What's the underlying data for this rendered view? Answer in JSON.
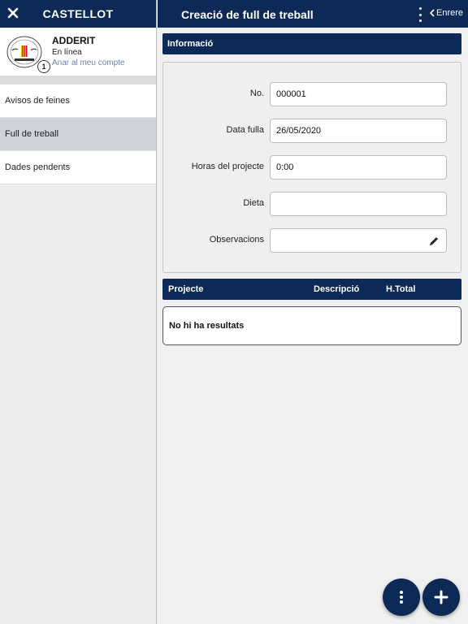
{
  "sidebar": {
    "title": "CASTELLOT",
    "profile": {
      "name": "ADDERIT",
      "status": "En línea",
      "account_link": "Anar al meu compte",
      "badge_count": "1"
    },
    "items": [
      {
        "label": "Avisos de feines",
        "active": false
      },
      {
        "label": "Full de treball",
        "active": true
      },
      {
        "label": "Dades pendents",
        "active": false
      }
    ]
  },
  "header": {
    "title": "Creació de full de treball",
    "back_label": "Enrere",
    "menu_icon": "kebab-menu-icon"
  },
  "info_section": {
    "title": "Informació",
    "fields": [
      {
        "label": "No.",
        "value": "000001"
      },
      {
        "label": "Data fulla",
        "value": "26/05/2020"
      },
      {
        "label": "Horas del projecte",
        "value": "0:00"
      },
      {
        "label": "Dieta",
        "value": ""
      },
      {
        "label": "Observacions",
        "value": ""
      }
    ]
  },
  "projects_table": {
    "columns": [
      "Projecte",
      "Descripció",
      "H.Total"
    ],
    "empty_text": "No hi ha resultats"
  },
  "fabs": {
    "more_icon": "vertical-dots-icon",
    "add_icon": "plus-icon"
  },
  "colors": {
    "primary": "#0d2a57",
    "link": "#6b82ad",
    "active_item": "#cfd2d8"
  }
}
